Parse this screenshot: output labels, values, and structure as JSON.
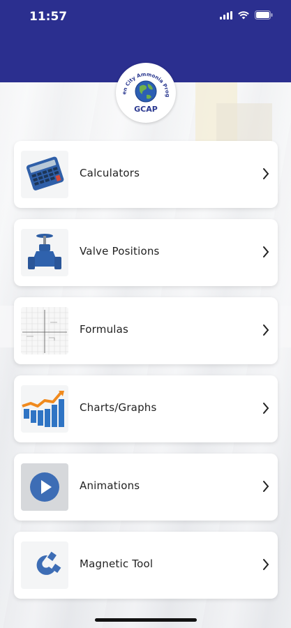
{
  "status_bar": {
    "time": "11:57"
  },
  "logo": {
    "ring_text": "Garden City Ammonia Program",
    "abbrev": "GCAP"
  },
  "menu": {
    "items": [
      {
        "label": "Calculators",
        "icon": "calculator-icon"
      },
      {
        "label": "Valve Positions",
        "icon": "valve-icon"
      },
      {
        "label": "Formulas",
        "icon": "graph-paper-icon"
      },
      {
        "label": "Charts/Graphs",
        "icon": "bar-chart-icon"
      },
      {
        "label": "Animations",
        "icon": "play-icon"
      },
      {
        "label": "Magnetic Tool",
        "icon": "magnet-icon"
      }
    ]
  },
  "colors": {
    "header": "#2b2f8f",
    "accent_blue": "#3d6db5"
  }
}
